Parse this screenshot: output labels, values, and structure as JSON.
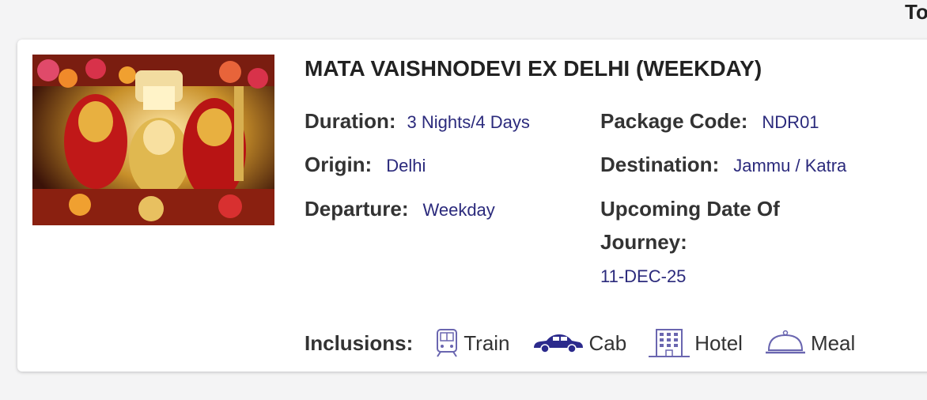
{
  "corner_text": "To",
  "package": {
    "title": "MATA VAISHNODEVI EX DELHI (WEEKDAY)",
    "image_alt": "Mata Vaishnodevi shrine",
    "duration_label": "Duration:",
    "duration_value": "3 Nights/4 Days",
    "code_label": "Package Code:",
    "code_value": "NDR01",
    "origin_label": "Origin:",
    "origin_value": "Delhi",
    "destination_label": "Destination:",
    "destination_value": "Jammu / Katra",
    "departure_label": "Departure:",
    "departure_value": "Weekday",
    "upcoming_label_line1": "Upcoming Date Of",
    "upcoming_label_line2": "Journey:",
    "upcoming_value": "11-DEC-25",
    "inclusions_label": "Inclusions:",
    "inclusions": [
      {
        "icon": "train-icon",
        "label": "Train"
      },
      {
        "icon": "car-icon",
        "label": "Cab"
      },
      {
        "icon": "hotel-icon",
        "label": "Hotel"
      },
      {
        "icon": "meal-cloche-icon",
        "label": "Meal"
      }
    ]
  },
  "colors": {
    "value_text": "#2b2a7c",
    "icon_stroke": "#6a66b0",
    "car_fill": "#2b2a8c"
  }
}
